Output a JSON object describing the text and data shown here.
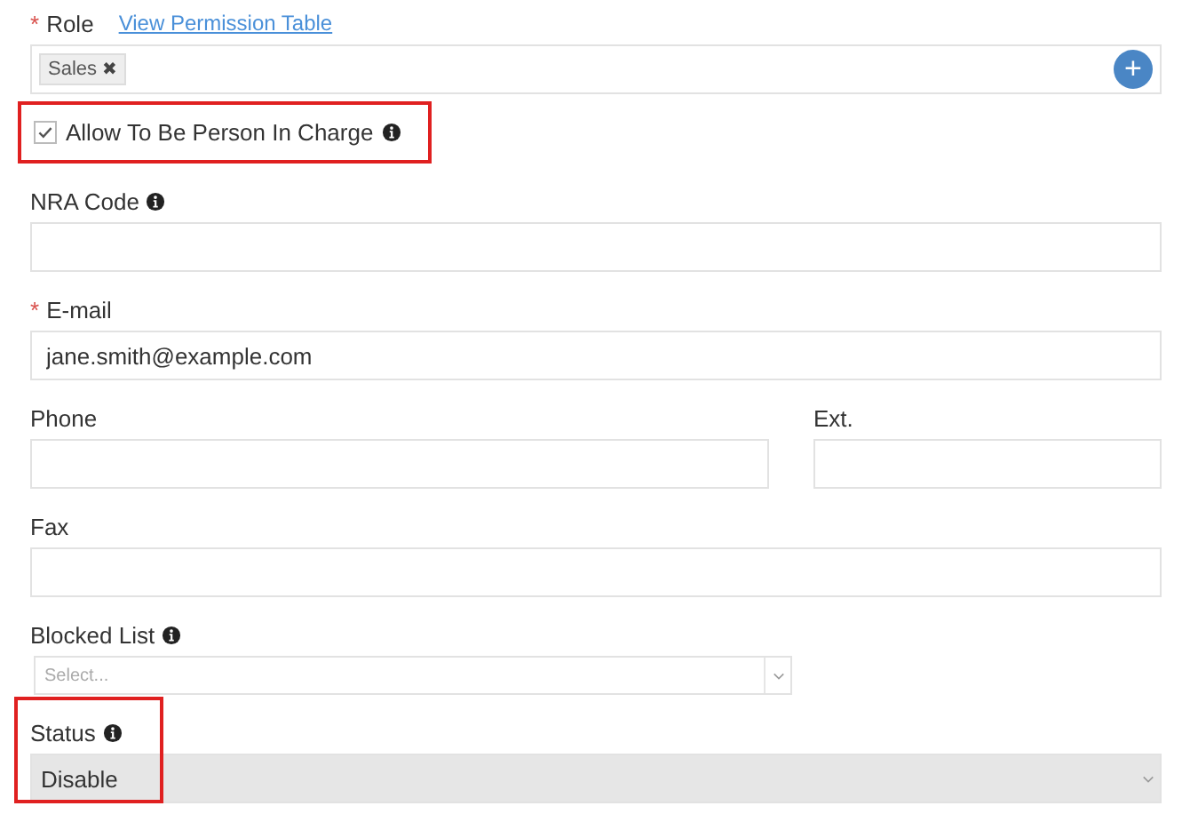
{
  "role": {
    "label": "Role",
    "mark": "*",
    "link": "View Permission Table",
    "tags": [
      {
        "label": "Sales",
        "remove": "✖"
      }
    ],
    "add_button": "+"
  },
  "person_in_charge": {
    "label": "Allow To Be Person In Charge",
    "checked": true,
    "info": true,
    "highlighted": true
  },
  "rows": [
    [
      {
        "kind": "text",
        "label": "NRA Code",
        "info": true
      }
    ],
    [
      {
        "kind": "text",
        "label": "E-mail",
        "info": false,
        "mark": "*",
        "value": "jane.smith@example.com"
      }
    ],
    [
      {
        "kind": "text",
        "label": "Phone",
        "info": false
      },
      {
        "kind": "text",
        "label": "Ext.",
        "info": false
      }
    ],
    [
      {
        "kind": "text",
        "label": "Fax",
        "info": false
      }
    ],
    [
      {
        "kind": "select",
        "label": "Blocked List",
        "info": true,
        "placeholder": "Select...",
        "disabled": false,
        "highlighted": false
      }
    ],
    [
      {
        "kind": "select",
        "label": "Status",
        "info": true,
        "value": "Disable",
        "disabled": true,
        "highlighted": true
      }
    ]
  ]
}
